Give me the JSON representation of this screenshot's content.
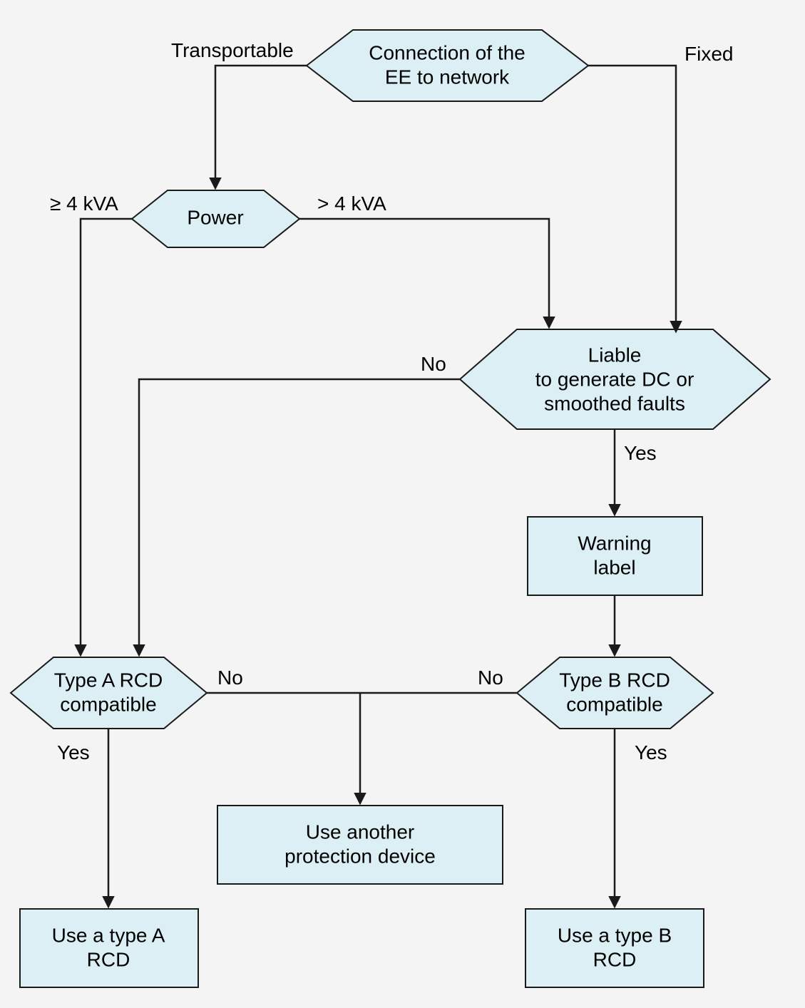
{
  "nodes": {
    "connection": {
      "line1": "Connection of the",
      "line2": "EE to network"
    },
    "power": {
      "line1": "Power"
    },
    "liable": {
      "line1": "Liable",
      "line2": "to generate DC or",
      "line3": "smoothed faults"
    },
    "warning": {
      "line1": "Warning",
      "line2": "label"
    },
    "rcdA": {
      "line1": "Type A RCD",
      "line2": "compatible"
    },
    "rcdB": {
      "line1": "Type B RCD",
      "line2": "compatible"
    },
    "another": {
      "line1": "Use another",
      "line2": "protection device"
    },
    "useA": {
      "line1": "Use a type A",
      "line2": "RCD"
    },
    "useB": {
      "line1": "Use a type B",
      "line2": "RCD"
    }
  },
  "edges": {
    "transportable": "Transportable",
    "fixed": "Fixed",
    "ge4": "≥ 4 kVA",
    "gt4": "> 4 kVA",
    "noLiable": "No",
    "yesLiable": "Yes",
    "noA": "No",
    "noB": "No",
    "yesA": "Yes",
    "yesB": "Yes"
  }
}
